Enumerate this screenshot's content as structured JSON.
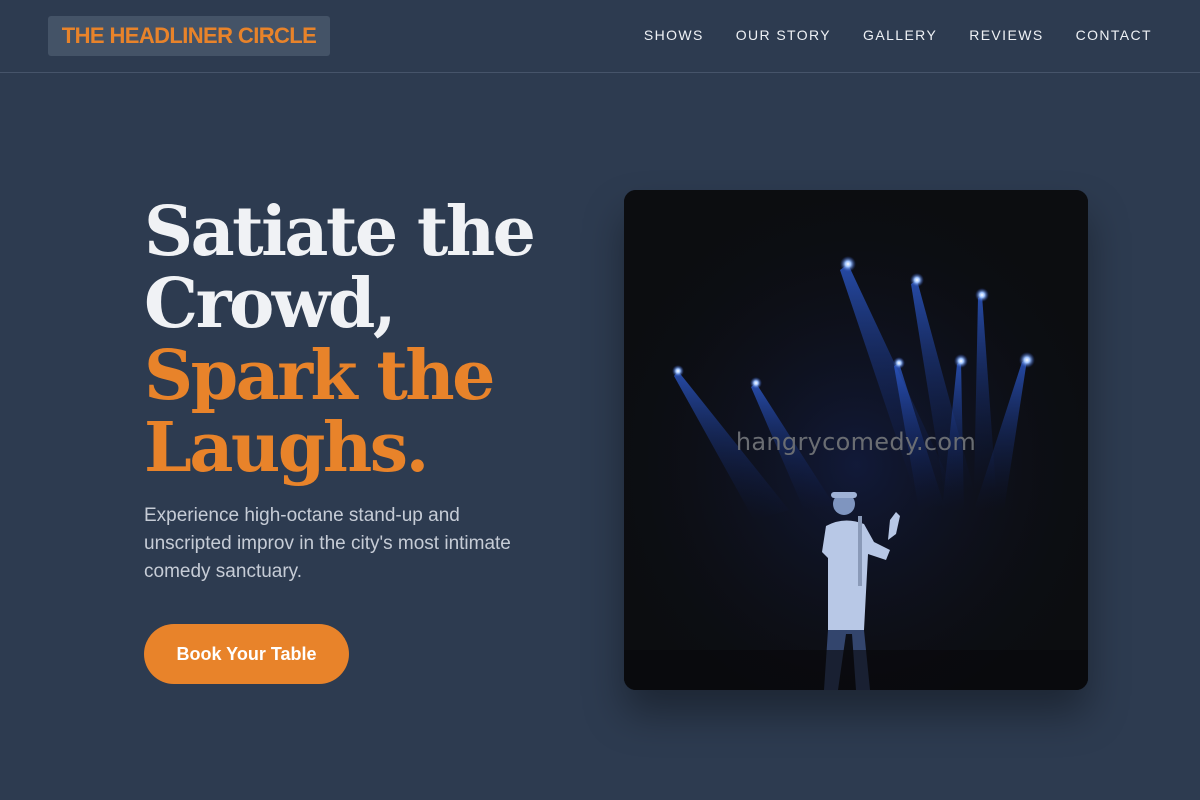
{
  "brand": {
    "name": "THE HEADLINER CIRCLE"
  },
  "nav": {
    "items": [
      {
        "label": "SHOWS"
      },
      {
        "label": "OUR STORY"
      },
      {
        "label": "GALLERY"
      },
      {
        "label": "REVIEWS"
      },
      {
        "label": "CONTACT"
      }
    ]
  },
  "hero": {
    "headline_line1": "Satiate the",
    "headline_line2": "Crowd,",
    "headline_line3": "Spark the",
    "headline_line4": "Laughs.",
    "subtitle": "Experience high-octane stand-up and unscripted improv in the city's most intimate comedy sanctuary.",
    "cta_label": "Book Your Table",
    "image_watermark": "hangrycomedy.com",
    "image_icon": "comedian-on-stage-photo"
  },
  "colors": {
    "background": "#2d3b50",
    "accent": "#e8832a",
    "text_light": "#f0f2f5",
    "text_muted": "#c6ccd6"
  }
}
